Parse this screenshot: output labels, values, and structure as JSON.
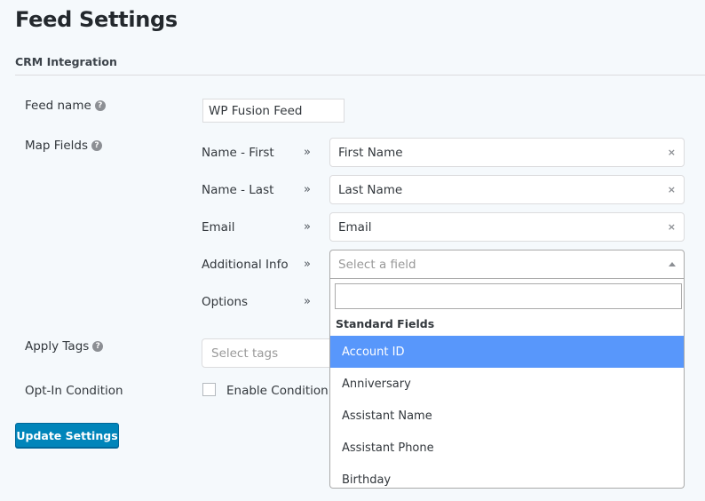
{
  "header": {
    "title": "Feed Settings",
    "section": "CRM Integration"
  },
  "feed_name": {
    "label": "Feed name",
    "help_icon": "question-circle-icon",
    "value": "WP Fusion Feed"
  },
  "map_fields": {
    "label": "Map Fields",
    "help_icon": "question-circle-icon",
    "arrow_glyph": "»",
    "clear_glyph": "×",
    "rows": [
      {
        "label": "Name - First",
        "value": "First Name"
      },
      {
        "label": "Name - Last",
        "value": "Last Name"
      },
      {
        "label": "Email",
        "value": "Email"
      },
      {
        "label": "Additional Info",
        "value": "",
        "placeholder": "Select a field"
      },
      {
        "label": "Options",
        "value": ""
      }
    ]
  },
  "dropdown": {
    "search_value": "",
    "group_label": "Standard Fields",
    "options": [
      {
        "label": "Account ID",
        "highlighted": true
      },
      {
        "label": "Anniversary",
        "highlighted": false
      },
      {
        "label": "Assistant Name",
        "highlighted": false
      },
      {
        "label": "Assistant Phone",
        "highlighted": false
      },
      {
        "label": "Birthday",
        "highlighted": false
      }
    ]
  },
  "apply_tags": {
    "label": "Apply Tags",
    "help_icon": "question-circle-icon",
    "placeholder": "Select tags"
  },
  "opt_in": {
    "label": "Opt-In Condition",
    "checkbox_label": "Enable Condition",
    "checked": false
  },
  "actions": {
    "update_label": "Update Settings"
  },
  "colors": {
    "primary_button": "#0085ba",
    "highlight": "#5897fb",
    "background": "#f5f9fc"
  }
}
